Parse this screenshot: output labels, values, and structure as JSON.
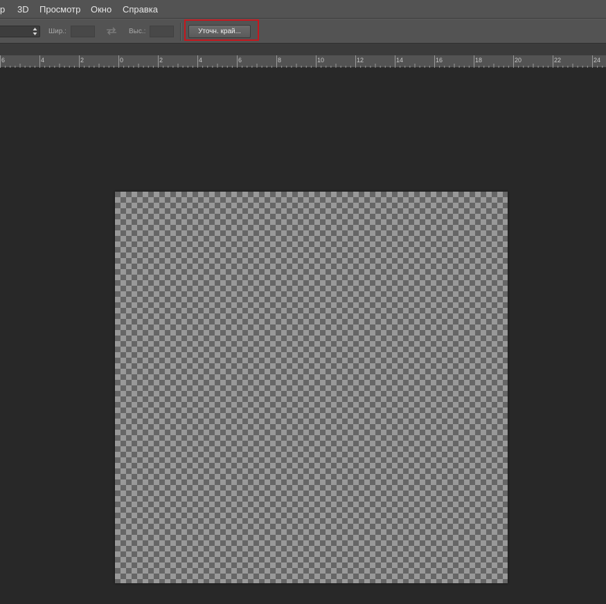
{
  "menu": {
    "items": [
      {
        "label": "р"
      },
      {
        "label": "3D"
      },
      {
        "label": "Просмотр"
      },
      {
        "label": "Окно"
      },
      {
        "label": "Справка"
      }
    ]
  },
  "options": {
    "width_label": "Шир.:",
    "width_value": "",
    "height_label": "Выс.:",
    "height_value": "",
    "refine_edge_label": "Уточн. край..."
  },
  "ruler": {
    "labels": [
      "6",
      "4",
      "2",
      "0",
      "2",
      "4",
      "6",
      "8",
      "10",
      "12",
      "14",
      "16",
      "18",
      "20",
      "22",
      "24"
    ]
  },
  "icons": {
    "style_select": "updown-arrows-icon",
    "swap": "swap-arrows-icon"
  },
  "colors": {
    "highlight": "#c8161d",
    "panel": "#535353",
    "workspace": "#282828"
  }
}
